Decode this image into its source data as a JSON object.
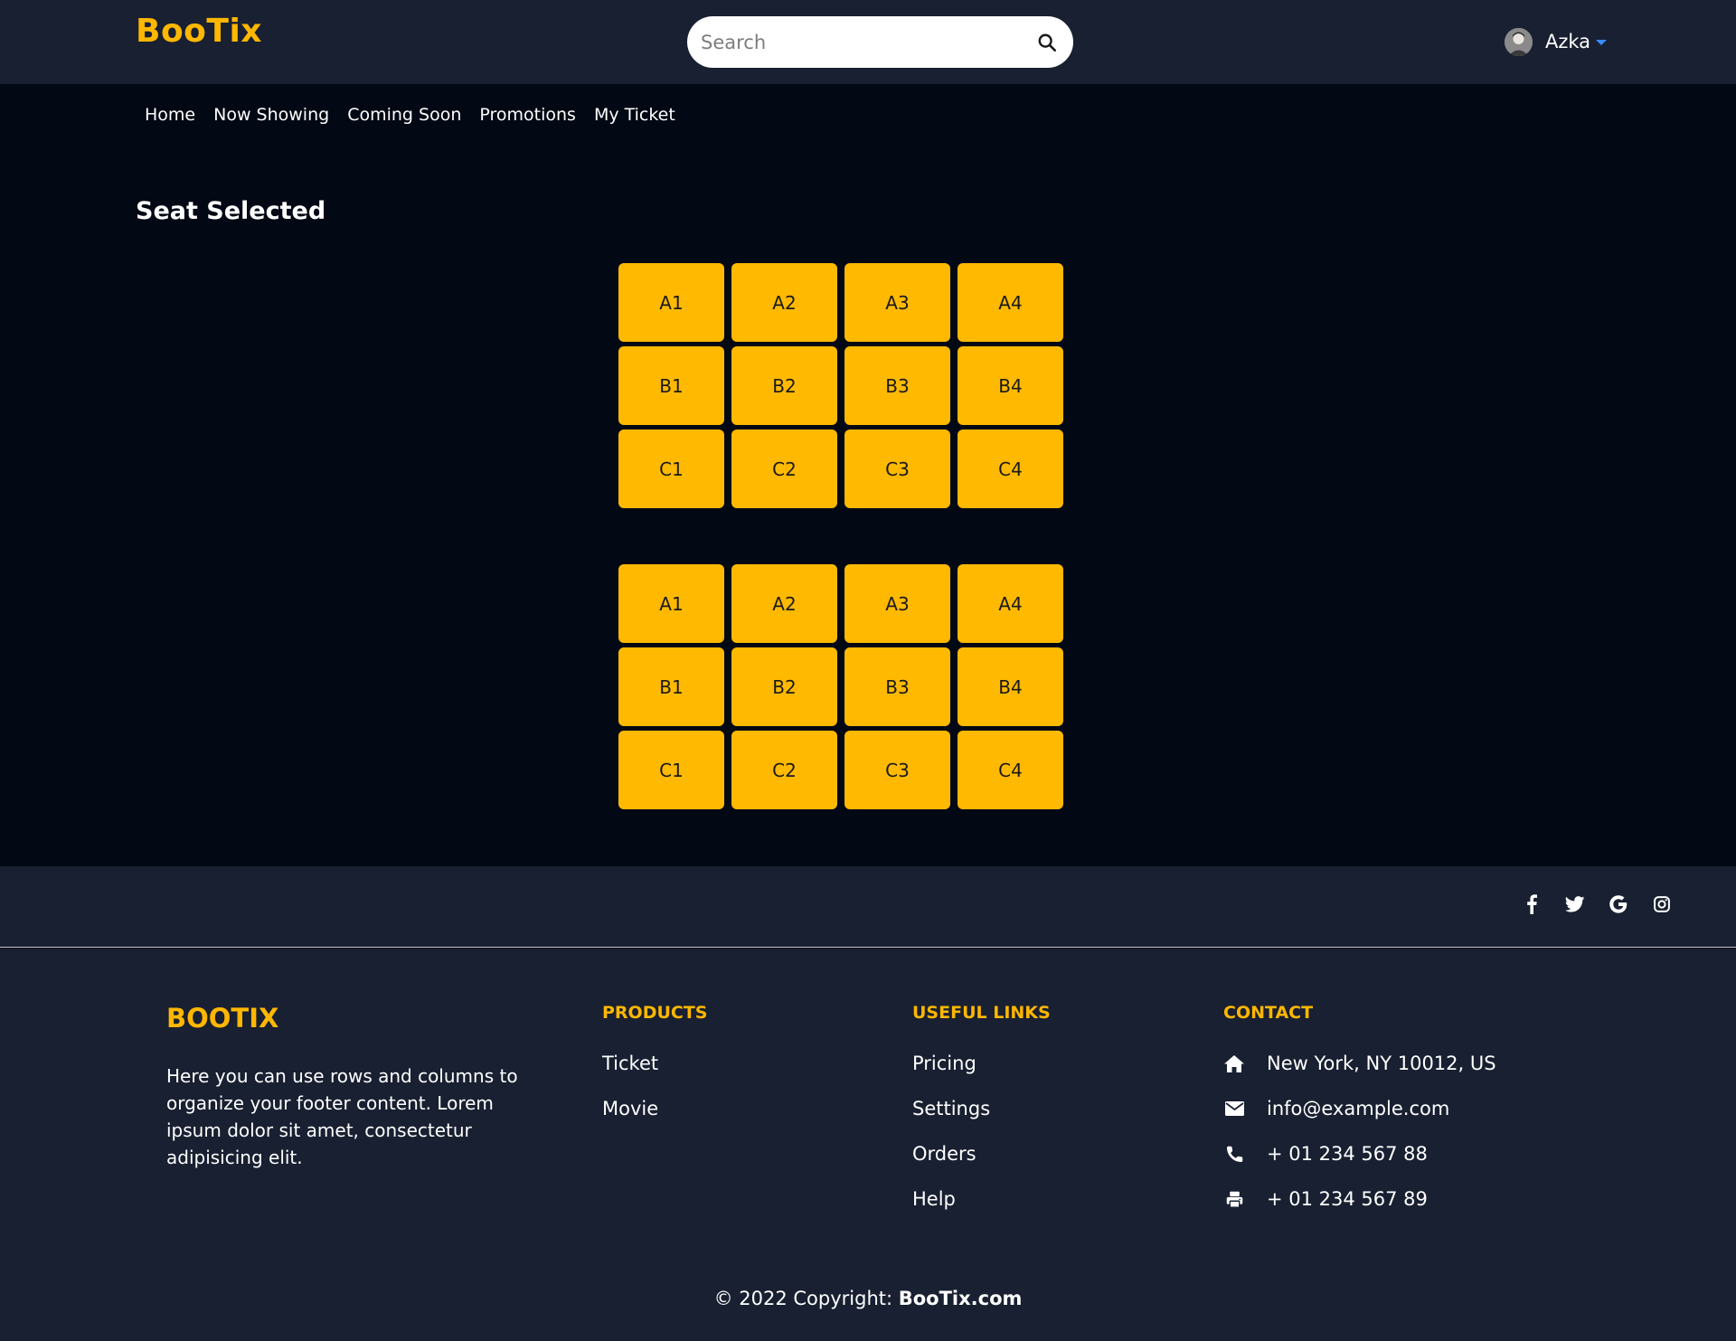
{
  "header": {
    "brand": "BooTix",
    "search_placeholder": "Search",
    "user_name": "Azka"
  },
  "nav": {
    "items": [
      "Home",
      "Now Showing",
      "Coming Soon",
      "Promotions",
      "My Ticket"
    ]
  },
  "main": {
    "title": "Seat Selected",
    "seat_groups": [
      {
        "seats": [
          "A1",
          "A2",
          "A3",
          "A4",
          "B1",
          "B2",
          "B3",
          "B4",
          "C1",
          "C2",
          "C3",
          "C4"
        ]
      },
      {
        "seats": [
          "A1",
          "A2",
          "A3",
          "A4",
          "B1",
          "B2",
          "B3",
          "B4",
          "C1",
          "C2",
          "C3",
          "C4"
        ]
      }
    ],
    "seat_color": "#ffb900"
  },
  "social": {
    "icons": [
      "facebook-icon",
      "twitter-icon",
      "google-icon",
      "instagram-icon"
    ]
  },
  "footer": {
    "brand": "BOOTIX",
    "description": "Here you can use rows and columns to organize your footer content. Lorem ipsum dolor sit amet, consectetur adipisicing elit.",
    "products": {
      "heading": "PRODUCTS",
      "links": [
        "Ticket",
        "Movie"
      ]
    },
    "useful_links": {
      "heading": "USEFUL LINKS",
      "links": [
        "Pricing",
        "Settings",
        "Orders",
        "Help"
      ]
    },
    "contact": {
      "heading": "CONTACT",
      "address": "New York, NY 10012, US",
      "email": "info@example.com",
      "phone": "+ 01 234 567 88",
      "fax": "+ 01 234 567 89"
    },
    "copyright_prefix": "© 2022 Copyright: ",
    "copyright_site": "BooTix.com"
  },
  "colors": {
    "accent": "#ffb701",
    "header_bg": "#182031",
    "page_bg": "#020814"
  }
}
